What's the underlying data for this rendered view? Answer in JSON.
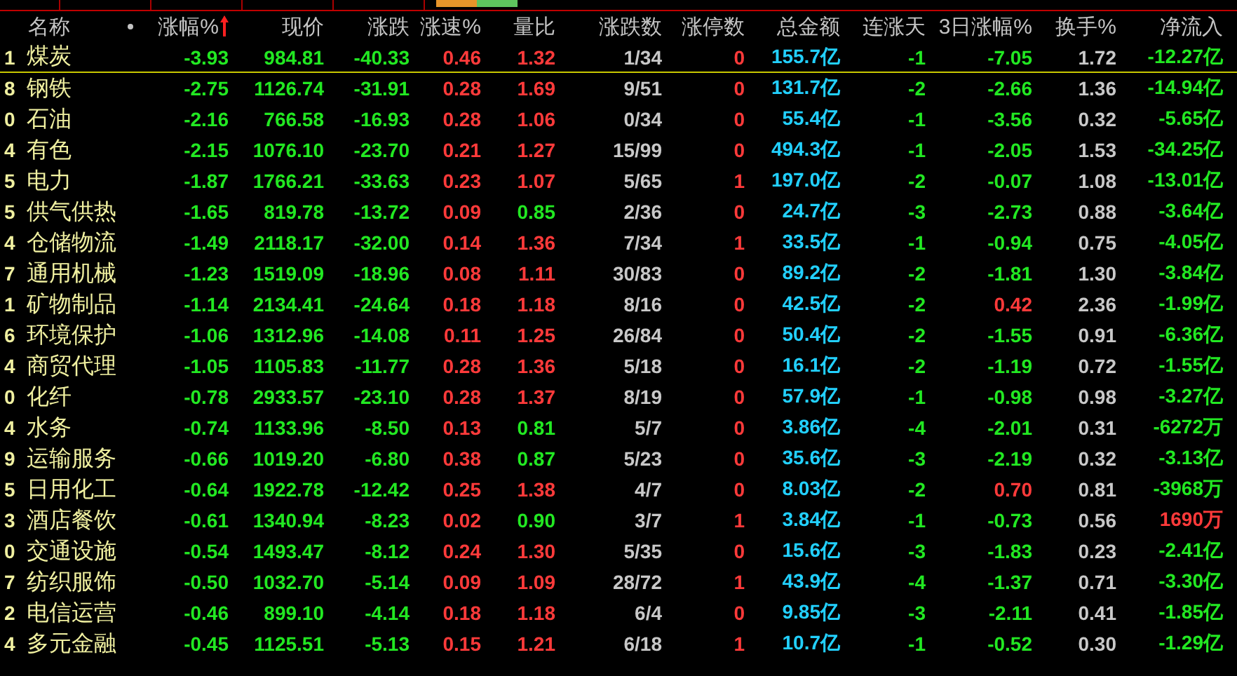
{
  "table": {
    "columns": [
      {
        "label": "名称",
        "sorted": false
      },
      {
        "label": "涨幅%",
        "sorted": true
      },
      {
        "label": "现价",
        "sorted": false
      },
      {
        "label": "涨跌",
        "sorted": false
      },
      {
        "label": "涨速%",
        "sorted": false
      },
      {
        "label": "量比",
        "sorted": false
      },
      {
        "label": "涨跌数",
        "sorted": false
      },
      {
        "label": "涨停数",
        "sorted": false
      },
      {
        "label": "总金额",
        "sorted": false
      },
      {
        "label": "连涨天",
        "sorted": false
      },
      {
        "label": "3日涨幅%",
        "sorted": false
      },
      {
        "label": "换手%",
        "sorted": false
      },
      {
        "label": "净流入",
        "sorted": false
      }
    ],
    "rows": [
      {
        "code": "1",
        "cells": [
          "煤炭",
          "-3.93",
          "984.81",
          "-40.33",
          "0.46",
          "1.32",
          "1/34",
          "0",
          "155.7亿",
          "-1",
          "-7.05",
          "1.72",
          "-12.27亿"
        ],
        "selected": true
      },
      {
        "code": "8",
        "cells": [
          "钢铁",
          "-2.75",
          "1126.74",
          "-31.91",
          "0.28",
          "1.69",
          "9/51",
          "0",
          "131.7亿",
          "-2",
          "-2.66",
          "1.36",
          "-14.94亿"
        ],
        "selected": false
      },
      {
        "code": "0",
        "cells": [
          "石油",
          "-2.16",
          "766.58",
          "-16.93",
          "0.28",
          "1.06",
          "0/34",
          "0",
          "55.4亿",
          "-1",
          "-3.56",
          "0.32",
          "-5.65亿"
        ],
        "selected": false
      },
      {
        "code": "4",
        "cells": [
          "有色",
          "-2.15",
          "1076.10",
          "-23.70",
          "0.21",
          "1.27",
          "15/99",
          "0",
          "494.3亿",
          "-1",
          "-2.05",
          "1.53",
          "-34.25亿"
        ],
        "selected": false
      },
      {
        "code": "5",
        "cells": [
          "电力",
          "-1.87",
          "1766.21",
          "-33.63",
          "0.23",
          "1.07",
          "5/65",
          "1",
          "197.0亿",
          "-2",
          "-0.07",
          "1.08",
          "-13.01亿"
        ],
        "selected": false
      },
      {
        "code": "5",
        "cells": [
          "供气供热",
          "-1.65",
          "819.78",
          "-13.72",
          "0.09",
          "0.85",
          "2/36",
          "0",
          "24.7亿",
          "-3",
          "-2.73",
          "0.88",
          "-3.64亿"
        ],
        "selected": false
      },
      {
        "code": "4",
        "cells": [
          "仓储物流",
          "-1.49",
          "2118.17",
          "-32.00",
          "0.14",
          "1.36",
          "7/34",
          "1",
          "33.5亿",
          "-1",
          "-0.94",
          "0.75",
          "-4.05亿"
        ],
        "selected": false
      },
      {
        "code": "7",
        "cells": [
          "通用机械",
          "-1.23",
          "1519.09",
          "-18.96",
          "0.08",
          "1.11",
          "30/83",
          "0",
          "89.2亿",
          "-2",
          "-1.81",
          "1.30",
          "-3.84亿"
        ],
        "selected": false
      },
      {
        "code": "1",
        "cells": [
          "矿物制品",
          "-1.14",
          "2134.41",
          "-24.64",
          "0.18",
          "1.18",
          "8/16",
          "0",
          "42.5亿",
          "-2",
          "0.42",
          "2.36",
          "-1.99亿"
        ],
        "selected": false
      },
      {
        "code": "6",
        "cells": [
          "环境保护",
          "-1.06",
          "1312.96",
          "-14.08",
          "0.11",
          "1.25",
          "26/84",
          "0",
          "50.4亿",
          "-2",
          "-1.55",
          "0.91",
          "-6.36亿"
        ],
        "selected": false
      },
      {
        "code": "4",
        "cells": [
          "商贸代理",
          "-1.05",
          "1105.83",
          "-11.77",
          "0.28",
          "1.36",
          "5/18",
          "0",
          "16.1亿",
          "-2",
          "-1.19",
          "0.72",
          "-1.55亿"
        ],
        "selected": false
      },
      {
        "code": "0",
        "cells": [
          "化纤",
          "-0.78",
          "2933.57",
          "-23.10",
          "0.28",
          "1.37",
          "8/19",
          "0",
          "57.9亿",
          "-1",
          "-0.98",
          "0.98",
          "-3.27亿"
        ],
        "selected": false
      },
      {
        "code": "4",
        "cells": [
          "水务",
          "-0.74",
          "1133.96",
          "-8.50",
          "0.13",
          "0.81",
          "5/7",
          "0",
          "3.86亿",
          "-4",
          "-2.01",
          "0.31",
          "-6272万"
        ],
        "selected": false
      },
      {
        "code": "9",
        "cells": [
          "运输服务",
          "-0.66",
          "1019.20",
          "-6.80",
          "0.38",
          "0.87",
          "5/23",
          "0",
          "35.6亿",
          "-3",
          "-2.19",
          "0.32",
          "-3.13亿"
        ],
        "selected": false
      },
      {
        "code": "5",
        "cells": [
          "日用化工",
          "-0.64",
          "1922.78",
          "-12.42",
          "0.25",
          "1.38",
          "4/7",
          "0",
          "8.03亿",
          "-2",
          "0.70",
          "0.81",
          "-3968万"
        ],
        "selected": false
      },
      {
        "code": "3",
        "cells": [
          "酒店餐饮",
          "-0.61",
          "1340.94",
          "-8.23",
          "0.02",
          "0.90",
          "3/7",
          "1",
          "3.84亿",
          "-1",
          "-0.73",
          "0.56",
          "1690万"
        ],
        "selected": false
      },
      {
        "code": "0",
        "cells": [
          "交通设施",
          "-0.54",
          "1493.47",
          "-8.12",
          "0.24",
          "1.30",
          "5/35",
          "0",
          "15.6亿",
          "-3",
          "-1.83",
          "0.23",
          "-2.41亿"
        ],
        "selected": false
      },
      {
        "code": "7",
        "cells": [
          "纺织服饰",
          "-0.50",
          "1032.70",
          "-5.14",
          "0.09",
          "1.09",
          "28/72",
          "1",
          "43.9亿",
          "-4",
          "-1.37",
          "0.71",
          "-3.30亿"
        ],
        "selected": false
      },
      {
        "code": "2",
        "cells": [
          "电信运营",
          "-0.46",
          "899.10",
          "-4.14",
          "0.18",
          "1.18",
          "6/4",
          "0",
          "9.85亿",
          "-3",
          "-2.11",
          "0.41",
          "-1.85亿"
        ],
        "selected": false
      },
      {
        "code": "4",
        "cells": [
          "多元金融",
          "-0.45",
          "1125.51",
          "-5.13",
          "0.15",
          "1.21",
          "6/18",
          "1",
          "10.7亿",
          "-1",
          "-0.52",
          "0.30",
          "-1.29亿"
        ],
        "selected": false
      }
    ]
  }
}
